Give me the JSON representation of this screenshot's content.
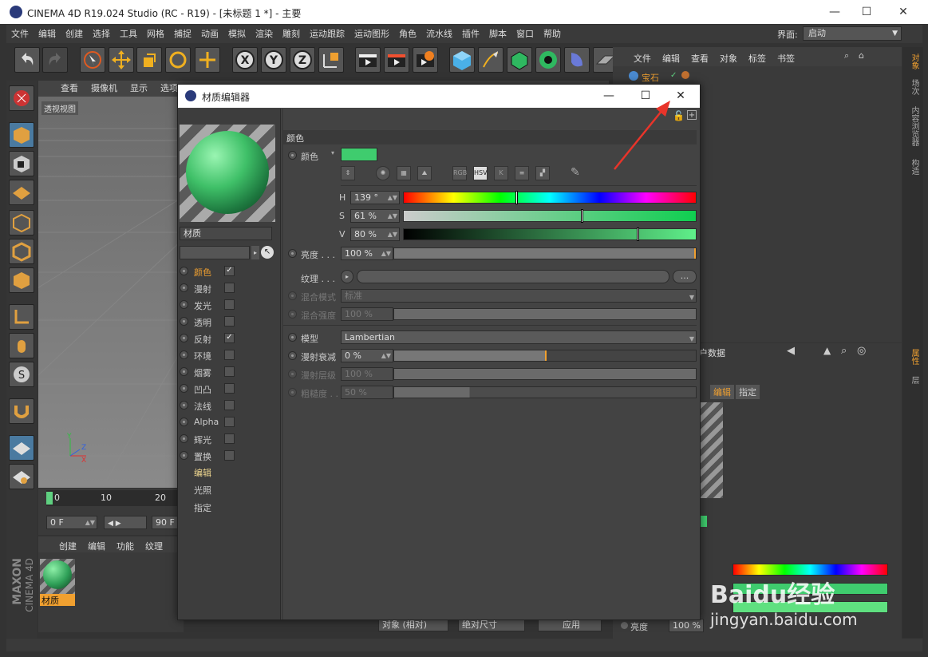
{
  "window": {
    "title": "CINEMA 4D R19.024 Studio (RC - R19) - [未标题 1 *] - 主要",
    "minimize": "—",
    "maximize": "☐",
    "close": "✕"
  },
  "menu": {
    "items": [
      "文件",
      "编辑",
      "创建",
      "选择",
      "工具",
      "网格",
      "捕捉",
      "动画",
      "模拟",
      "渲染",
      "雕刻",
      "运动跟踪",
      "运动图形",
      "角色",
      "流水线",
      "插件",
      "脚本",
      "窗口",
      "帮助"
    ],
    "layout_label": "界面:",
    "layout_value": "启动"
  },
  "viewport": {
    "menu": [
      "查看",
      "摄像机",
      "显示",
      "选项"
    ],
    "name": "透视视图"
  },
  "timeline": {
    "ticks": [
      "0",
      "10",
      "20"
    ],
    "start_frame": "0 F",
    "end_frame": "90 F"
  },
  "material_manager": {
    "menu": [
      "创建",
      "编辑",
      "功能",
      "纹理"
    ],
    "material_name": "材质"
  },
  "object_manager": {
    "menu": [
      "文件",
      "编辑",
      "查看",
      "对象",
      "标签",
      "书签"
    ],
    "object_name": "宝石"
  },
  "attribute_manager": {
    "header_text": "户数据",
    "tabs": [
      "编辑",
      "指定"
    ],
    "brightness_label": "亮度",
    "brightness_value": "100 %",
    "coord_mode": "对象 (相对)",
    "size_mode": "绝对尺寸",
    "apply_label": "应用"
  },
  "right_tabs": [
    "对象",
    "场次",
    "内容浏览器",
    "构造",
    "属性",
    "层"
  ],
  "dialog": {
    "title": "材质编辑器",
    "minimize": "—",
    "maximize": "☐",
    "close": "✕",
    "material_name": "材质",
    "channels": [
      {
        "label": "颜色",
        "checked": "✓",
        "active": "yes"
      },
      {
        "label": "漫射",
        "checked": "",
        "active": ""
      },
      {
        "label": "发光",
        "checked": "",
        "active": ""
      },
      {
        "label": "透明",
        "checked": "",
        "active": ""
      },
      {
        "label": "反射",
        "checked": "✓",
        "active": ""
      },
      {
        "label": "环境",
        "checked": "",
        "active": ""
      },
      {
        "label": "烟雾",
        "checked": "",
        "active": ""
      },
      {
        "label": "凹凸",
        "checked": "",
        "active": ""
      },
      {
        "label": "法线",
        "checked": "",
        "active": ""
      },
      {
        "label": "Alpha",
        "checked": "",
        "active": ""
      },
      {
        "label": "辉光",
        "checked": "",
        "active": ""
      },
      {
        "label": "置换",
        "checked": "",
        "active": ""
      }
    ],
    "extra_tabs": [
      "编辑",
      "光照",
      "指定"
    ],
    "section_title": "颜色",
    "color_label": "颜色",
    "color_swatch": "#3fcc6e",
    "mode_buttons": [
      "RGB",
      "HSV",
      "K"
    ],
    "hsv": {
      "h_label": "H",
      "h_value": "139 °",
      "h_fraction": 0.386,
      "s_label": "S",
      "s_value": "61 %",
      "s_fraction": 0.61,
      "v_label": "V",
      "v_value": "80 %",
      "v_fraction": 0.8
    },
    "brightness_label": "亮度 . . .",
    "brightness_value": "100 %",
    "texture_label": "纹理 . . .",
    "texture_more": "...",
    "blend_mode_label": "混合模式",
    "blend_mode_value": "标准",
    "blend_strength_label": "混合强度",
    "blend_strength_value": "100 %",
    "model_label": "模型",
    "model_value": "Lambertian",
    "diffuse_falloff_label": "漫射衰减",
    "diffuse_falloff_value": "0 %",
    "diffuse_level_label": "漫射层级",
    "diffuse_level_value": "100 %",
    "roughness_label": "粗糙度 . .",
    "roughness_value": "50 %"
  },
  "colors": {
    "accent_orange": "#f0a030",
    "material_green": "#3fcc6e",
    "annotation_red": "#e8342a"
  },
  "watermark": "Baidu经验 jingyan.baidu.com"
}
